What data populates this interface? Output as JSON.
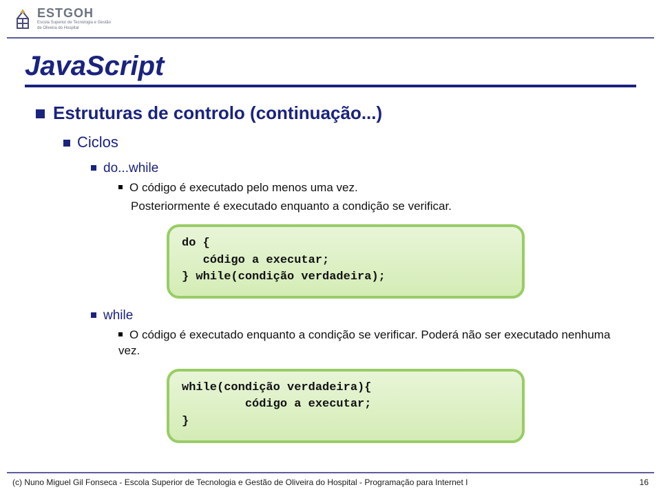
{
  "logo": {
    "main": "ESTGOH",
    "sub1": "Escola Superior de Tecnologia e Gestão",
    "sub2": "de Oliveira do Hospital"
  },
  "title": "JavaScript",
  "section": {
    "h1": "Estruturas de controlo (continuação...)",
    "h2": "Ciclos",
    "dowhile": {
      "heading": "do...while",
      "line1": "O código é executado pelo menos uma vez.",
      "line2": "Posteriormente é executado enquanto a condição se verificar.",
      "code": "do {\n   código a executar;\n} while(condição verdadeira);"
    },
    "while": {
      "heading": "while",
      "line1": "O código é executado enquanto a condição se verificar. Poderá não ser executado nenhuma vez.",
      "code": "while(condição verdadeira){\n         código a executar;\n}"
    }
  },
  "footer": {
    "left": "(c) Nuno Miguel Gil Fonseca  -  Escola Superior de Tecnologia e Gestão de Oliveira do Hospital  -  Programação para Internet I",
    "page": "16"
  }
}
